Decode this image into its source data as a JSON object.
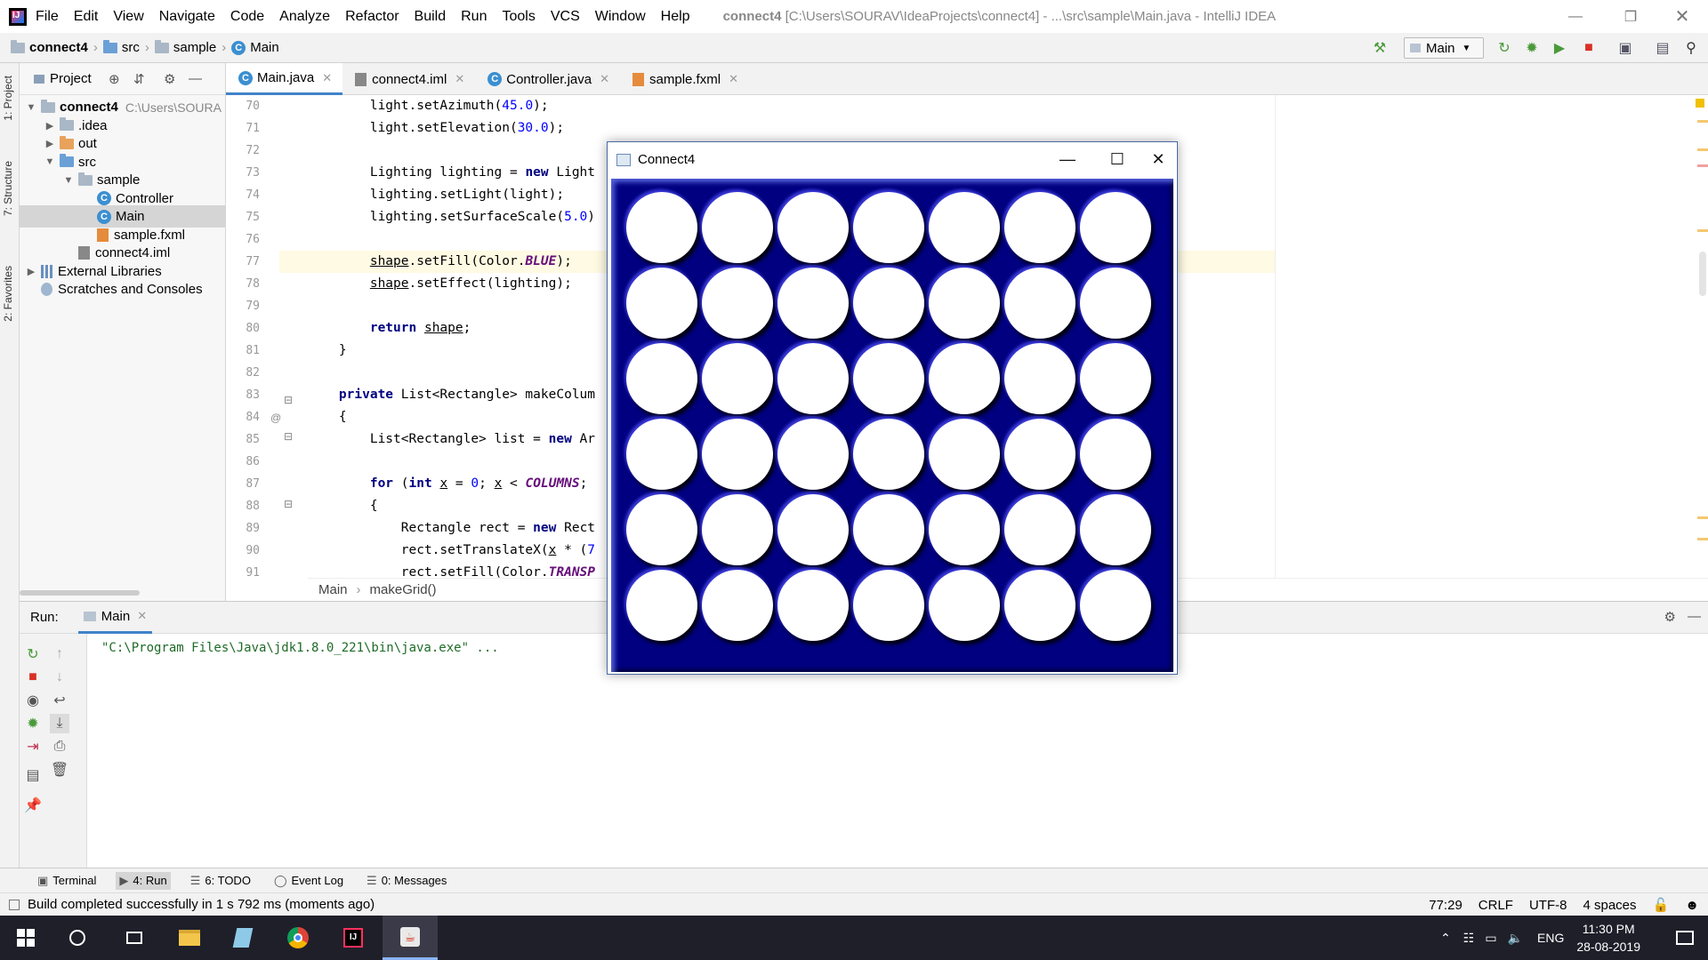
{
  "menu": [
    "File",
    "Edit",
    "View",
    "Navigate",
    "Code",
    "Analyze",
    "Refactor",
    "Build",
    "Run",
    "Tools",
    "VCS",
    "Window",
    "Help"
  ],
  "window_title": {
    "project": "connect4",
    "rest": "[C:\\Users\\SOURAV\\IdeaProjects\\connect4] - ...\\src\\sample\\Main.java - IntelliJ IDEA"
  },
  "breadcrumb": [
    "connect4",
    "src",
    "sample",
    "Main"
  ],
  "run_config": "Main",
  "left_strip": [
    "1: Project",
    "7: Structure",
    "2: Favorites"
  ],
  "project_panel": {
    "title": "Project",
    "tree": [
      {
        "label": "connect4",
        "extra": "C:\\Users\\SOURA",
        "depth": 0,
        "arrow": "▼",
        "icon": "folder",
        "bold": true
      },
      {
        "label": ".idea",
        "depth": 1,
        "arrow": "▶",
        "icon": "folder"
      },
      {
        "label": "out",
        "depth": 1,
        "arrow": "▶",
        "icon": "folder-orange"
      },
      {
        "label": "src",
        "depth": 1,
        "arrow": "▼",
        "icon": "folder-blue"
      },
      {
        "label": "sample",
        "depth": 2,
        "arrow": "▼",
        "icon": "folder"
      },
      {
        "label": "Controller",
        "depth": 3,
        "arrow": "",
        "icon": "class"
      },
      {
        "label": "Main",
        "depth": 3,
        "arrow": "",
        "icon": "class",
        "selected": true
      },
      {
        "label": "sample.fxml",
        "depth": 3,
        "arrow": "",
        "icon": "xml"
      },
      {
        "label": "connect4.iml",
        "depth": 2,
        "arrow": "",
        "icon": "file"
      },
      {
        "label": "External Libraries",
        "depth": 0,
        "arrow": "▶",
        "icon": "lib"
      },
      {
        "label": "Scratches and Consoles",
        "depth": 0,
        "arrow": "",
        "icon": "scratch"
      }
    ]
  },
  "editor_tabs": [
    {
      "label": "Main.java",
      "icon": "class",
      "active": true
    },
    {
      "label": "connect4.iml",
      "icon": "file"
    },
    {
      "label": "Controller.java",
      "icon": "class"
    },
    {
      "label": "sample.fxml",
      "icon": "xml"
    }
  ],
  "code_lines": [
    {
      "n": "70",
      "html": "        light.setAzimuth(<span class=\"num\">45.0</span>);"
    },
    {
      "n": "71",
      "html": "        light.setElevation(<span class=\"num\">30.0</span>);"
    },
    {
      "n": "72",
      "html": ""
    },
    {
      "n": "73",
      "html": "        Lighting lighting = <span class=\"kw\">new</span> Light"
    },
    {
      "n": "74",
      "html": "        lighting.setLight(light);"
    },
    {
      "n": "75",
      "html": "        lighting.setSurfaceScale(<span class=\"num\">5.0</span>)"
    },
    {
      "n": "76",
      "html": ""
    },
    {
      "n": "77",
      "html": "        <span class=\"ul\">shape</span>.setFill(Color.<span class=\"fld\">BLUE</span>);",
      "hl": true
    },
    {
      "n": "78",
      "html": "        <span class=\"ul\">shape</span>.setEffect(lighting);"
    },
    {
      "n": "79",
      "html": ""
    },
    {
      "n": "80",
      "html": "        <span class=\"kw\">return</span> <span class=\"ul\">shape</span>;"
    },
    {
      "n": "81",
      "html": "    }"
    },
    {
      "n": "82",
      "html": ""
    },
    {
      "n": "83",
      "html": "    <span class=\"kw\">private</span> List&lt;Rectangle&gt; makeColum"
    },
    {
      "n": "84",
      "html": "    {"
    },
    {
      "n": "85",
      "html": "        List&lt;Rectangle&gt; list = <span class=\"kw\">new</span> Ar"
    },
    {
      "n": "86",
      "html": ""
    },
    {
      "n": "87",
      "html": "        <span class=\"kw\">for</span> (<span class=\"kw\">int</span> <span class=\"ul\">x</span> = <span class=\"num\">0</span>; <span class=\"ul\">x</span> &lt; <span class=\"fld\">COLUMNS</span>;"
    },
    {
      "n": "88",
      "html": "        {"
    },
    {
      "n": "89",
      "html": "            Rectangle rect = <span class=\"kw\">new</span> Rect"
    },
    {
      "n": "90",
      "html": "            rect.setTranslateX(<span class=\"ul\">x</span> * (<span class=\"num\">7</span>"
    },
    {
      "n": "91",
      "html": "            rect.setFill(Color.<span class=\"fld\">TRANSP</span>"
    }
  ],
  "editor_breadcrumb": [
    "Main",
    "makeGrid()"
  ],
  "run_panel": {
    "label": "Run:",
    "tab": "Main",
    "output": "\"C:\\Program Files\\Java\\jdk1.8.0_221\\bin\\java.exe\" ..."
  },
  "bottom_tabs": [
    {
      "label": "Terminal"
    },
    {
      "label": "4: Run",
      "active": true
    },
    {
      "label": "6: TODO"
    },
    {
      "label": "Event Log"
    },
    {
      "label": "0: Messages"
    }
  ],
  "status": {
    "message": "Build completed successfully in 1 s 792 ms (moments ago)",
    "position": "77:29",
    "line_sep": "CRLF",
    "encoding": "UTF-8",
    "indent": "4 spaces"
  },
  "taskbar": {
    "lang": "ENG",
    "time": "11:30 PM",
    "date": "28-08-2019"
  },
  "connect4": {
    "title": "Connect4",
    "rows": 6,
    "columns": 7,
    "board_color": "#000080"
  },
  "colors": {
    "accent": "#4083c9",
    "run_output": "#1d6b27"
  }
}
